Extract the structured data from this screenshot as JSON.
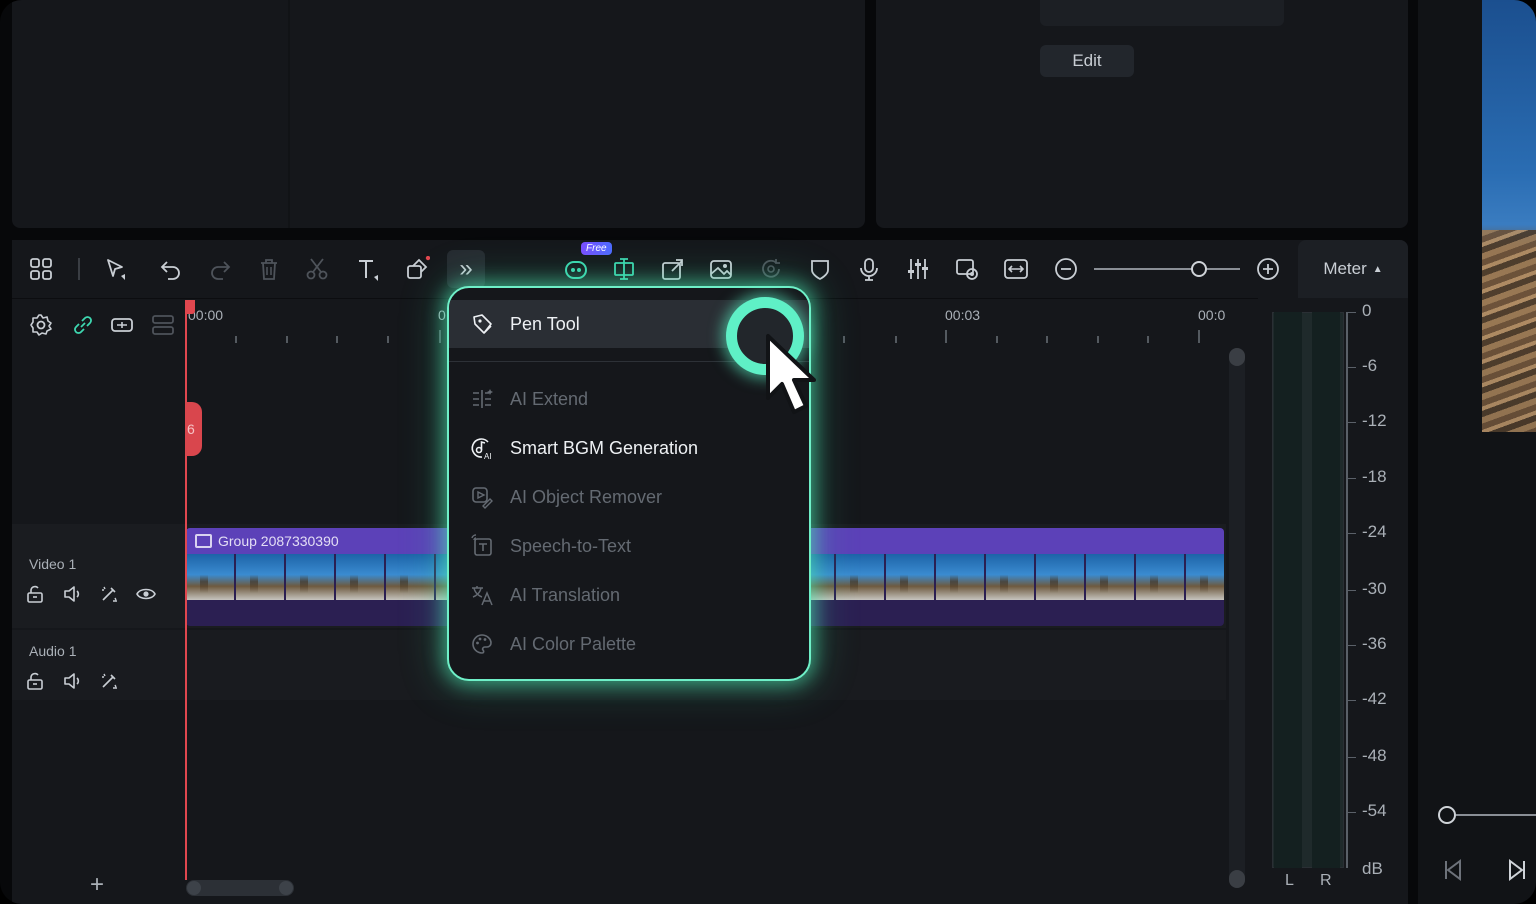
{
  "panels": {
    "edit_label": "Edit"
  },
  "toolbar": {
    "free_badge": "Free",
    "meter_label": "Meter",
    "meter_arrow": "▲",
    "more_glyph": "»"
  },
  "ruler": {
    "labels": [
      "00:00",
      "0",
      "00:03",
      "00:0"
    ]
  },
  "playhead": {
    "marker_text": "6"
  },
  "tracks": {
    "video_label": "Video 1",
    "audio_label": "Audio 1",
    "clip_title": "Group 2087330390",
    "add_glyph": "+"
  },
  "meter": {
    "db_labels": [
      "0",
      "-6",
      "-12",
      "-18",
      "-24",
      "-30",
      "-36",
      "-42",
      "-48",
      "-54",
      "dB"
    ],
    "left_label": "L",
    "right_label": "R"
  },
  "menu": {
    "items": [
      {
        "label": "Pen Tool",
        "icon": "pen-tool-icon",
        "enabled": true,
        "active": true
      },
      {
        "label": "AI Extend",
        "icon": "ai-extend-icon",
        "enabled": false
      },
      {
        "label": "Smart BGM Generation",
        "icon": "smart-bgm-icon",
        "enabled": true
      },
      {
        "label": "AI Object Remover",
        "icon": "object-remover-icon",
        "enabled": false
      },
      {
        "label": "Speech-to-Text",
        "icon": "speech-to-text-icon",
        "enabled": false
      },
      {
        "label": "AI Translation",
        "icon": "translation-icon",
        "enabled": false
      },
      {
        "label": "AI Color Palette",
        "icon": "color-palette-icon",
        "enabled": false
      }
    ]
  },
  "colors": {
    "accent": "#3ed7b0",
    "highlight_glow": "#6ff0c8",
    "playhead": "#e0474f",
    "clip_header": "#5c41b8"
  }
}
